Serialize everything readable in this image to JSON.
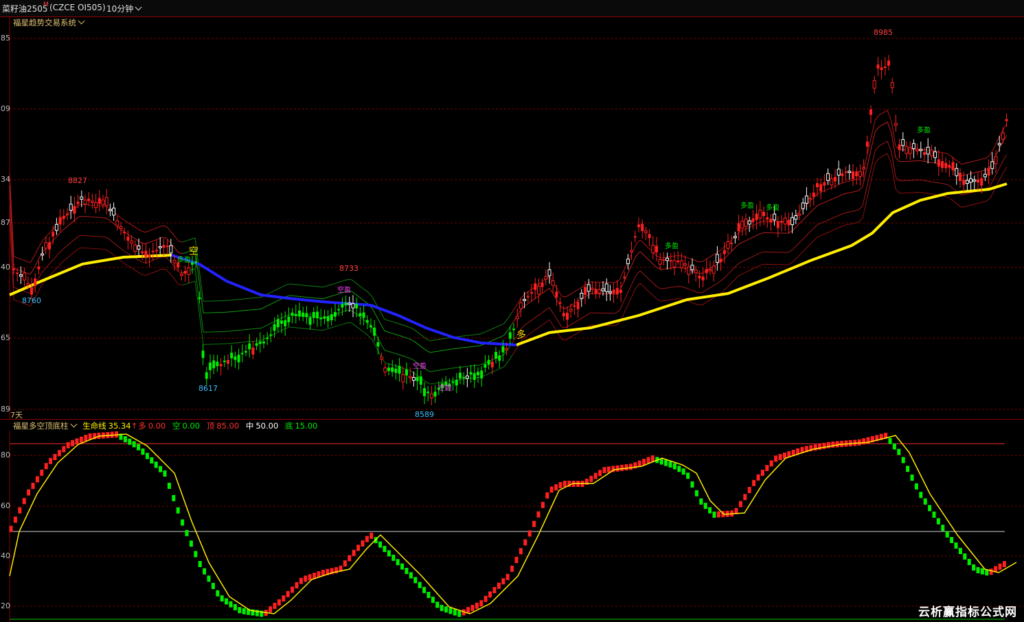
{
  "symbol": "菜籽油2505",
  "symbol_mark": "M",
  "contract": "(CZCE OI505)",
  "period": "10分钟",
  "main_indicator": "福星趋势交易系统",
  "time_marker": "7天",
  "price_axis": [
    "85",
    "09",
    "34",
    "87",
    "40",
    "65",
    "89"
  ],
  "sub_indicator": {
    "name": "福星多空顶底柱",
    "life_line_label": "生命线",
    "life_line_value": "35.34",
    "life_arrow": "↑",
    "long_label": "多",
    "long_value": "0.00",
    "short_label": "空",
    "short_value": "0.00",
    "top_label": "顶",
    "top_value": "85.00",
    "mid_label": "中",
    "mid_value": "50.00",
    "bottom_label": "底",
    "bottom_value": "15.00"
  },
  "osc_axis": [
    "80",
    "60",
    "40",
    "20"
  ],
  "annotations": {
    "high_8827": "8827",
    "high_8733": "8733",
    "high_8985": "8985",
    "low_8617": "8617",
    "low_8589": "8589",
    "low_8760": "8760",
    "kong": "空",
    "duo": "多",
    "duo_ying": "多盈",
    "kong_ying": "空盈"
  },
  "watermark": "云析赢指标公式网",
  "colors": {
    "up": "#ff2020",
    "down": "#00ee00",
    "yellow": "#ffee00",
    "blue": "#2222ff",
    "grid": "#8b0000"
  }
}
